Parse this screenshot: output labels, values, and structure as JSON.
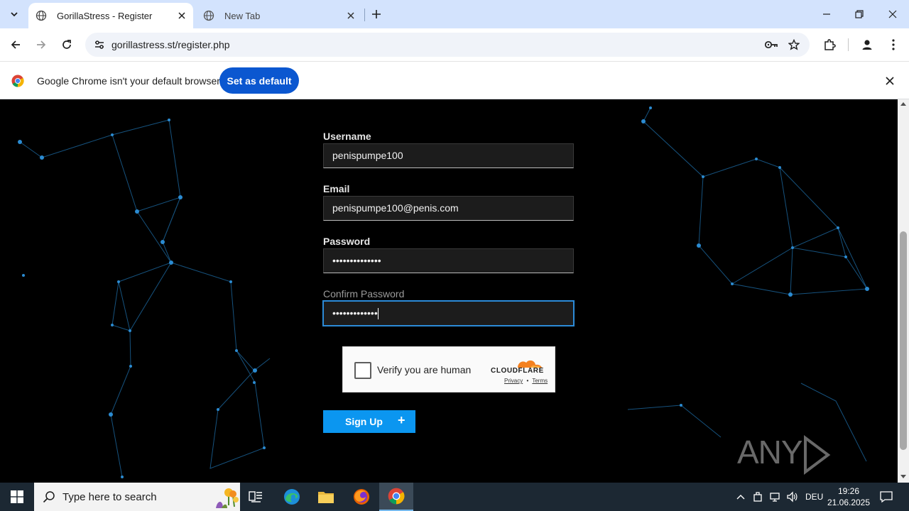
{
  "browser": {
    "tabs": [
      {
        "title": "GorillaStress - Register",
        "active": true
      },
      {
        "title": "New Tab",
        "active": false
      }
    ],
    "url": "gorillastress.st/register.php",
    "infobar": {
      "message": "Google Chrome isn't your default browser",
      "button": "Set as default"
    }
  },
  "form": {
    "username": {
      "label": "Username",
      "value": "penispumpe100"
    },
    "email": {
      "label": "Email",
      "value": "penispumpe100@penis.com"
    },
    "password": {
      "label": "Password",
      "value": "••••••••••••••"
    },
    "confirm_password": {
      "label": "Confirm Password",
      "value": "•••••••••••••"
    },
    "captcha": {
      "label": "Verify you are human",
      "brand": "CLOUDFLARE",
      "privacy": "Privacy",
      "sep": "•",
      "terms": "Terms"
    },
    "submit": {
      "label": "Sign Up",
      "icon": "+"
    }
  },
  "watermark": {
    "left": "ANY",
    "right": "RUN"
  },
  "taskbar": {
    "search_placeholder": "Type here to search",
    "language": "DEU",
    "time": "19:26",
    "date": "21.06.2025"
  },
  "colors": {
    "tabstrip": "#d3e3fd",
    "primary_button": "#0b57d0",
    "signup_button": "#0b96f0",
    "focus_border": "#2c8bd8",
    "network_lines": "#1e6ea8"
  }
}
